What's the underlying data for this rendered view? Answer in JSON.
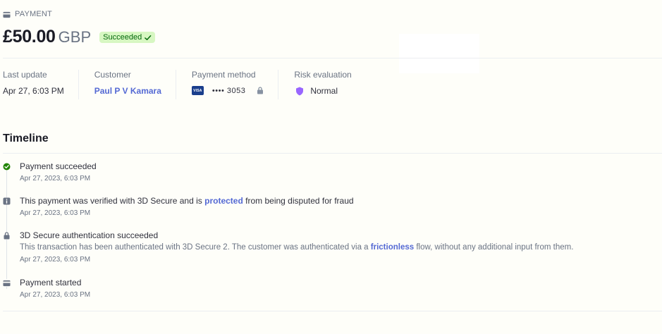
{
  "header": {
    "section_label": "PAYMENT"
  },
  "payment": {
    "amount": "£50.00",
    "currency": "GBP",
    "status": "Succeeded",
    "status_color": "#d7f7c2"
  },
  "meta": {
    "last_update": {
      "label": "Last update",
      "value": "Apr 27, 6:03 PM"
    },
    "customer": {
      "label": "Customer",
      "value": "Paul P V Kamara"
    },
    "payment_method": {
      "label": "Payment method",
      "card_brand": "VISA",
      "masked": "•••• 3053"
    },
    "risk": {
      "label": "Risk evaluation",
      "value": "Normal",
      "shield_color": "#9966ff"
    }
  },
  "timeline": {
    "title": "Timeline",
    "events": [
      {
        "title": "Payment succeeded",
        "time": "Apr 27, 2023, 6:03 PM",
        "icon": "check-circle-icon"
      },
      {
        "title_pre": "This payment was verified with 3D Secure and is ",
        "title_link": "protected",
        "title_post": " from being disputed for fraud",
        "time": "Apr 27, 2023, 6:03 PM",
        "icon": "info-icon"
      },
      {
        "title": "3D Secure authentication succeeded",
        "desc_pre": "This transaction has been authenticated with 3D Secure 2. The customer was authenticated via a ",
        "desc_link": "frictionless",
        "desc_post": " flow, without any additional input from them.",
        "time": "Apr 27, 2023, 6:03 PM",
        "icon": "lock-icon"
      },
      {
        "title": "Payment started",
        "time": "Apr 27, 2023, 6:03 PM",
        "icon": "payment-icon"
      }
    ]
  },
  "colors": {
    "accent": "#5469d4",
    "success": "#228403",
    "background": "#fefef9"
  }
}
